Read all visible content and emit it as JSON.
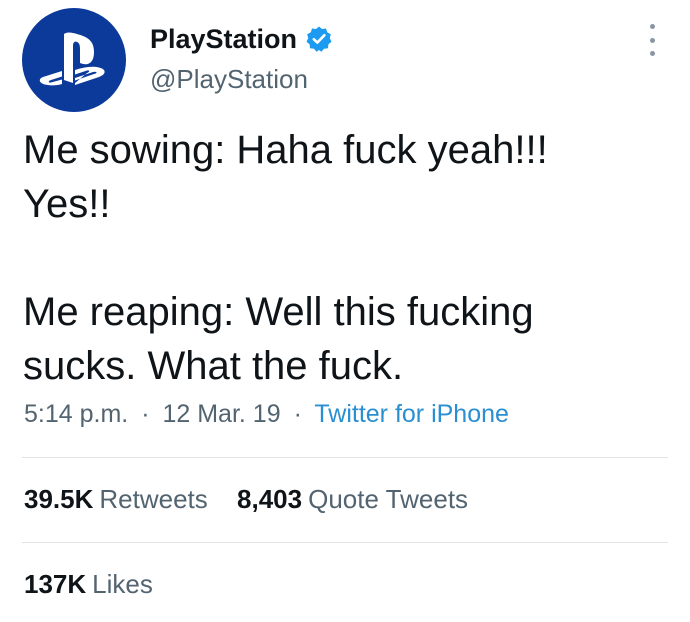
{
  "account": {
    "display_name": "PlayStation",
    "handle": "@PlayStation",
    "avatar_icon": "playstation-logo-icon",
    "verified_icon": "verified-badge-icon",
    "avatar_color": "#0b3a9a",
    "verified_color": "#1d9bf0"
  },
  "tweet": {
    "lines_part1": [
      "Me sowing: Haha fuck yeah!!!",
      "Yes!!"
    ],
    "lines_part2": [
      "Me reaping: Well this fucking",
      "sucks. What the fuck."
    ]
  },
  "meta": {
    "time": "5:14 p.m.",
    "separator": "·",
    "date": "12 Mar. 19",
    "source": "Twitter for iPhone"
  },
  "stats": {
    "retweets_count": "39.5K",
    "retweets_label": "Retweets",
    "quotes_count": "8,403",
    "quotes_label": "Quote Tweets",
    "likes_count": "137K",
    "likes_label": "Likes"
  },
  "more_icon": "more-options-icon"
}
